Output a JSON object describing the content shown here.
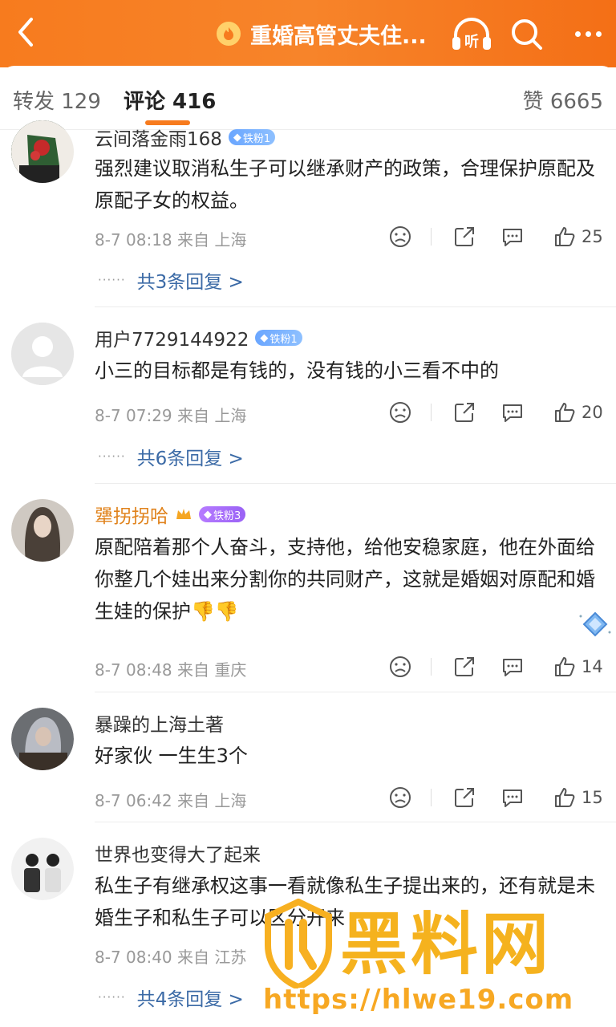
{
  "header": {
    "title": "重婚高管丈夫住...",
    "listen_label": "听",
    "accent_color": "#f77b1e"
  },
  "tabs": {
    "repost": "转发 129",
    "comment": "评论 416",
    "like": "赞 6665"
  },
  "comments": [
    {
      "name": "云间落金雨168",
      "badge": "铁粉1",
      "text": "强烈建议取消私生子可以继承财产的政策，合理保护原配及原配子女的权益。",
      "time": "8-7 08:18 来自 上海",
      "likes": "25",
      "replies": "共3条回复 >"
    },
    {
      "name": "用户7729144922",
      "badge": "铁粉1",
      "text": "小三的目标都是有钱的，没有钱的小三看不中的",
      "time": "8-7 07:29 来自 上海",
      "likes": "20",
      "replies": "共6条回复 >"
    },
    {
      "name": "犟拐拐哈",
      "badge": "铁粉3",
      "text": "原配陪着那个人奋斗，支持他，给他安稳家庭，他在外面给你整几个娃出来分割你的共同财产，这就是婚姻对原配和婚生娃的保护👎👎",
      "time": "8-7 08:48 来自 重庆",
      "likes": "14"
    },
    {
      "name": "暴躁的上海土著",
      "text": "好家伙 一生生3个",
      "time": "8-7 06:42 来自 上海",
      "likes": "15"
    },
    {
      "name": "世界也变得大了起来",
      "text": "私生子有继承权这事一看就像私生子提出来的，还有就是未婚生子和私生子可以区分开来",
      "time": "8-7 08:40 来自 江苏",
      "replies": "共4条回复 >"
    }
  ],
  "watermark": {
    "title": "黑料网",
    "url": "https://hlwe19.com"
  }
}
